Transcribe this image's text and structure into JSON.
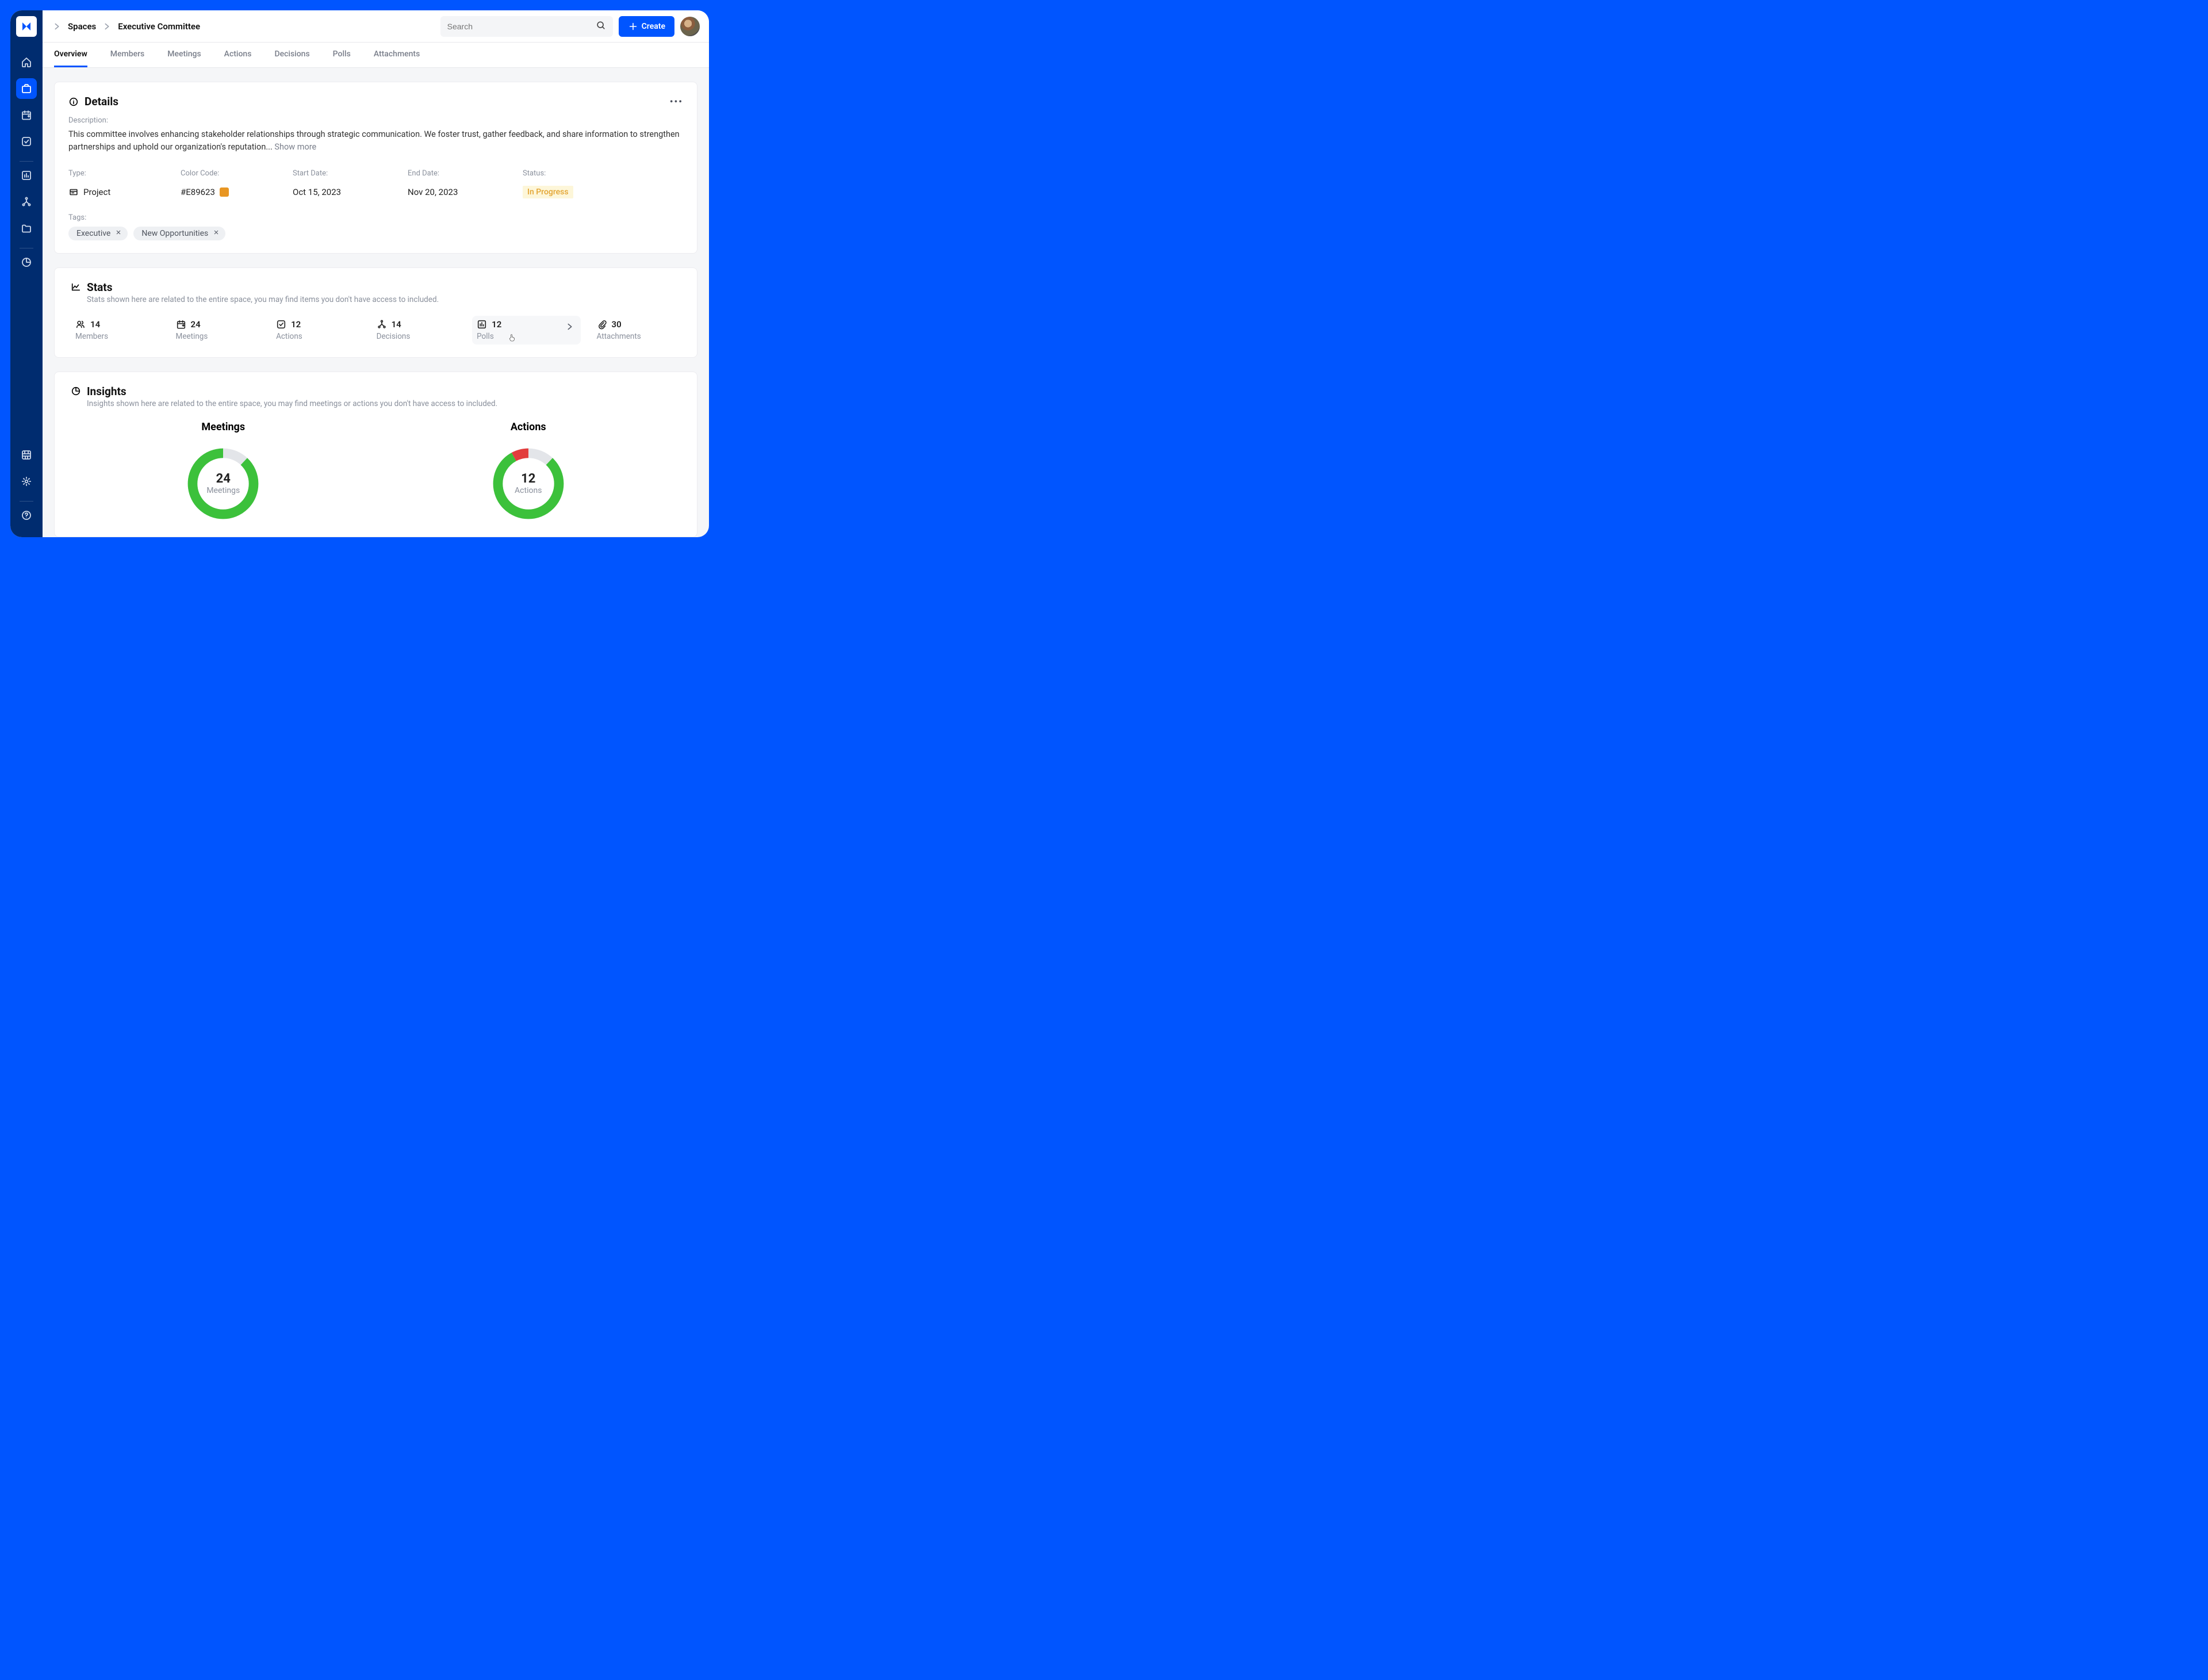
{
  "breadcrumb": {
    "level1": "Spaces",
    "level2": "Executive Committee"
  },
  "search": {
    "placeholder": "Search"
  },
  "create_button": {
    "label": "Create"
  },
  "tabs": [
    {
      "label": "Overview",
      "active": true
    },
    {
      "label": "Members"
    },
    {
      "label": "Meetings"
    },
    {
      "label": "Actions"
    },
    {
      "label": "Decisions"
    },
    {
      "label": "Polls"
    },
    {
      "label": "Attachments"
    }
  ],
  "details": {
    "title": "Details",
    "description_label": "Description:",
    "description": "This committee involves enhancing stakeholder relationships through strategic communication. We foster trust, gather feedback, and share information to strengthen partnerships and uphold our organization's reputation... ",
    "show_more": "Show more",
    "type_label": "Type:",
    "type_value": "Project",
    "color_label": "Color Code:",
    "color_value": "#E89623",
    "start_label": "Start Date:",
    "start_value": "Oct 15, 2023",
    "end_label": "End Date:",
    "end_value": "Nov 20, 2023",
    "status_label": "Status:",
    "status_value": "In Progress",
    "tags_label": "Tags:",
    "tags": [
      "Executive",
      "New Opportunities"
    ]
  },
  "stats": {
    "title": "Stats",
    "subtitle": "Stats shown here are related to the entire space, you may find items you don't have access to included.",
    "items": [
      {
        "value": "14",
        "label": "Members",
        "icon": "members"
      },
      {
        "value": "24",
        "label": "Meetings",
        "icon": "calendar"
      },
      {
        "value": "12",
        "label": "Actions",
        "icon": "check"
      },
      {
        "value": "14",
        "label": "Decisions",
        "icon": "branch"
      },
      {
        "value": "12",
        "label": "Polls",
        "icon": "chart",
        "hovered": true
      },
      {
        "value": "30",
        "label": "Attachments",
        "icon": "clip"
      }
    ]
  },
  "insights": {
    "title": "Insights",
    "subtitle": "Insights shown here are related to the entire space, you may find meetings or actions you don't have access to included.",
    "meetings": {
      "title": "Meetings",
      "value": "24",
      "label": "Meetings"
    },
    "actions": {
      "title": "Actions",
      "value": "12",
      "label": "Actions"
    }
  },
  "chart_data": [
    {
      "type": "pie",
      "title": "Meetings",
      "series": [
        {
          "name": "green",
          "value": 88,
          "color": "#3cc13b"
        },
        {
          "name": "grey",
          "value": 12,
          "color": "#e3e5e9"
        }
      ],
      "center_value": 24,
      "center_label": "Meetings"
    },
    {
      "type": "pie",
      "title": "Actions",
      "series": [
        {
          "name": "green",
          "value": 80,
          "color": "#3cc13b"
        },
        {
          "name": "red",
          "value": 8,
          "color": "#e23d3d"
        },
        {
          "name": "grey",
          "value": 12,
          "color": "#e3e5e9"
        }
      ],
      "center_value": 12,
      "center_label": "Actions"
    }
  ]
}
